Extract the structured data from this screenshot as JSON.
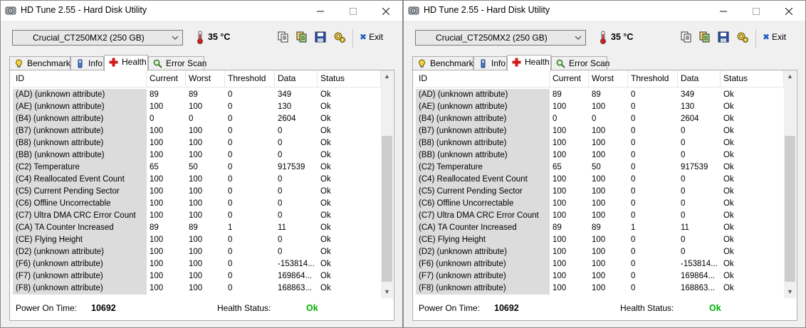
{
  "windows": [
    {
      "title": "HD Tune 2.55 - Hard Disk Utility",
      "drive": "Crucial_CT250MX2 (250 GB)",
      "temperature": "35 °C",
      "exit_label": "Exit",
      "tabs": [
        {
          "label": "Benchmark",
          "icon": "benchmark-icon",
          "active": false
        },
        {
          "label": "Info",
          "icon": "info-icon",
          "active": false
        },
        {
          "label": "Health",
          "icon": "health-cross-icon",
          "active": true
        },
        {
          "label": "Error Scan",
          "icon": "magnifier-icon",
          "active": false
        }
      ],
      "columns": [
        "ID",
        "Current",
        "Worst",
        "Threshold",
        "Data",
        "Status"
      ],
      "rows": [
        [
          "(AD) (unknown attribute)",
          "89",
          "89",
          "0",
          "349",
          "Ok"
        ],
        [
          "(AE) (unknown attribute)",
          "100",
          "100",
          "0",
          "130",
          "Ok"
        ],
        [
          "(B4) (unknown attribute)",
          "0",
          "0",
          "0",
          "2604",
          "Ok"
        ],
        [
          "(B7) (unknown attribute)",
          "100",
          "100",
          "0",
          "0",
          "Ok"
        ],
        [
          "(B8) (unknown attribute)",
          "100",
          "100",
          "0",
          "0",
          "Ok"
        ],
        [
          "(BB) (unknown attribute)",
          "100",
          "100",
          "0",
          "0",
          "Ok"
        ],
        [
          "(C2) Temperature",
          "65",
          "50",
          "0",
          "917539",
          "Ok"
        ],
        [
          "(C4) Reallocated Event Count",
          "100",
          "100",
          "0",
          "0",
          "Ok"
        ],
        [
          "(C5) Current Pending Sector",
          "100",
          "100",
          "0",
          "0",
          "Ok"
        ],
        [
          "(C6) Offline Uncorrectable",
          "100",
          "100",
          "0",
          "0",
          "Ok"
        ],
        [
          "(C7) Ultra DMA CRC Error Count",
          "100",
          "100",
          "0",
          "0",
          "Ok"
        ],
        [
          "(CA) TA Counter Increased",
          "89",
          "89",
          "1",
          "11",
          "Ok"
        ],
        [
          "(CE) Flying Height",
          "100",
          "100",
          "0",
          "0",
          "Ok"
        ],
        [
          "(D2) (unknown attribute)",
          "100",
          "100",
          "0",
          "0",
          "Ok"
        ],
        [
          "(F6) (unknown attribute)",
          "100",
          "100",
          "0",
          "-153814...",
          "Ok"
        ],
        [
          "(F7) (unknown attribute)",
          "100",
          "100",
          "0",
          "169864...",
          "Ok"
        ],
        [
          "(F8) (unknown attribute)",
          "100",
          "100",
          "0",
          "168863...",
          "Ok"
        ]
      ],
      "footer": {
        "power_on_label": "Power On Time:",
        "power_on_value": "10692",
        "health_label": "Health Status:",
        "health_value": "Ok"
      }
    },
    {
      "title": "HD Tune 2.55 - Hard Disk Utility",
      "drive": "Crucial_CT250MX2 (250 GB)",
      "temperature": "35 °C",
      "exit_label": "Exit",
      "tabs": [
        {
          "label": "Benchmark",
          "icon": "benchmark-icon",
          "active": false
        },
        {
          "label": "Info",
          "icon": "info-icon",
          "active": false
        },
        {
          "label": "Health",
          "icon": "health-cross-icon",
          "active": true
        },
        {
          "label": "Error Scan",
          "icon": "magnifier-icon",
          "active": false
        }
      ],
      "columns": [
        "ID",
        "Current",
        "Worst",
        "Threshold",
        "Data",
        "Status"
      ],
      "rows": [
        [
          "(AD) (unknown attribute)",
          "89",
          "89",
          "0",
          "349",
          "Ok"
        ],
        [
          "(AE) (unknown attribute)",
          "100",
          "100",
          "0",
          "130",
          "Ok"
        ],
        [
          "(B4) (unknown attribute)",
          "0",
          "0",
          "0",
          "2604",
          "Ok"
        ],
        [
          "(B7) (unknown attribute)",
          "100",
          "100",
          "0",
          "0",
          "Ok"
        ],
        [
          "(B8) (unknown attribute)",
          "100",
          "100",
          "0",
          "0",
          "Ok"
        ],
        [
          "(BB) (unknown attribute)",
          "100",
          "100",
          "0",
          "0",
          "Ok"
        ],
        [
          "(C2) Temperature",
          "65",
          "50",
          "0",
          "917539",
          "Ok"
        ],
        [
          "(C4) Reallocated Event Count",
          "100",
          "100",
          "0",
          "0",
          "Ok"
        ],
        [
          "(C5) Current Pending Sector",
          "100",
          "100",
          "0",
          "0",
          "Ok"
        ],
        [
          "(C6) Offline Uncorrectable",
          "100",
          "100",
          "0",
          "0",
          "Ok"
        ],
        [
          "(C7) Ultra DMA CRC Error Count",
          "100",
          "100",
          "0",
          "0",
          "Ok"
        ],
        [
          "(CA) TA Counter Increased",
          "89",
          "89",
          "1",
          "11",
          "Ok"
        ],
        [
          "(CE) Flying Height",
          "100",
          "100",
          "0",
          "0",
          "Ok"
        ],
        [
          "(D2) (unknown attribute)",
          "100",
          "100",
          "0",
          "0",
          "Ok"
        ],
        [
          "(F6) (unknown attribute)",
          "100",
          "100",
          "0",
          "-153814...",
          "Ok"
        ],
        [
          "(F7) (unknown attribute)",
          "100",
          "100",
          "0",
          "169864...",
          "Ok"
        ],
        [
          "(F8) (unknown attribute)",
          "100",
          "100",
          "0",
          "168863...",
          "Ok"
        ]
      ],
      "footer": {
        "power_on_label": "Power On Time:",
        "power_on_value": "10692",
        "health_label": "Health Status:",
        "health_value": "Ok"
      }
    }
  ]
}
